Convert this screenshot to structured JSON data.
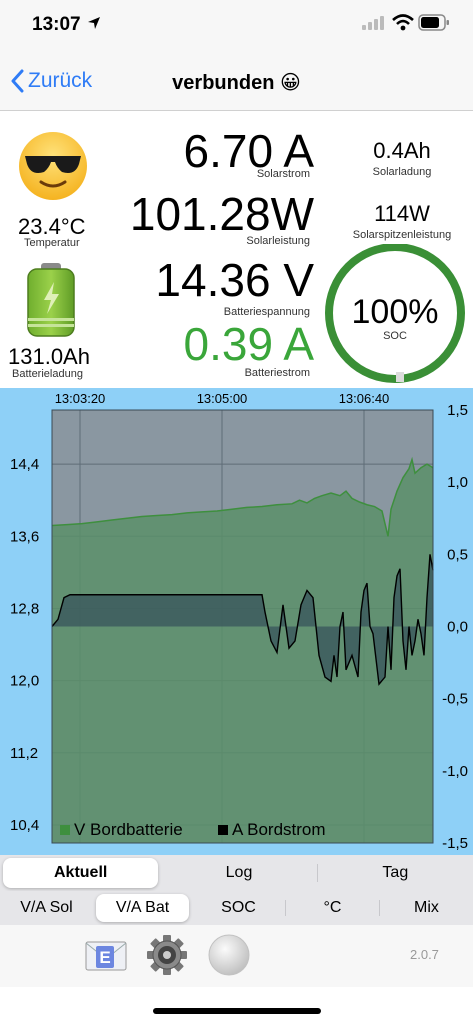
{
  "status_bar": {
    "time": "13:07"
  },
  "nav": {
    "back_label": "Zurück",
    "title": "verbunden 😀"
  },
  "dashboard": {
    "temperature": {
      "value": "23.4°C",
      "label": "Temperatur",
      "icon": "sunglasses-emoji-icon"
    },
    "battery_charge": {
      "value": "131.0Ah",
      "label": "Batterieladung",
      "icon": "battery-charging-icon"
    },
    "solar_current": {
      "value": "6.70 A",
      "label": "Solarstrom"
    },
    "solar_power": {
      "value": "101.28W",
      "label": "Solarleistung"
    },
    "battery_voltage": {
      "value": "14.36 V",
      "label": "Batteriespannung"
    },
    "battery_current": {
      "value": "0.39 A",
      "label": "Batteriestrom"
    },
    "solar_charge": {
      "value": "0.4Ah",
      "label": "Solarladung"
    },
    "solar_peak": {
      "value": "114W",
      "label": "Solarspitzenleistung"
    },
    "soc": {
      "value": "100%",
      "label": "SOC",
      "fraction": 1.0
    },
    "colors": {
      "green": "#3aa63a",
      "ring": "#3a8f36",
      "chart_bg": "#8ed0f7"
    }
  },
  "chart_data": {
    "type": "area",
    "x_ticks": [
      "13:03:20",
      "13:05:00",
      "13:06:40"
    ],
    "x_range": [
      "13:02:58",
      "13:07:02"
    ],
    "left_axis": {
      "ticks": [
        "14,4",
        "13,6",
        "12,8",
        "12,0",
        "11,2",
        "10,4"
      ],
      "ylim": [
        10.2,
        15.0
      ]
    },
    "right_axis": {
      "ticks": [
        "1,5",
        "1,0",
        "0,5",
        "0,0",
        "-0,5",
        "-1,0",
        "-1,5"
      ],
      "ylim": [
        -1.5,
        1.5
      ]
    },
    "legend": [
      "V Bordbatterie",
      "A Bordstrom"
    ],
    "legend_placement": "bottom",
    "grid": true,
    "series": [
      {
        "name": "V Bordbatterie",
        "axis": "left",
        "color": "#3e8f3e",
        "points": [
          [
            0,
            13.72
          ],
          [
            10,
            13.73
          ],
          [
            20,
            13.74
          ],
          [
            30,
            13.76
          ],
          [
            40,
            13.78
          ],
          [
            50,
            13.8
          ],
          [
            60,
            13.82
          ],
          [
            70,
            13.83
          ],
          [
            80,
            13.84
          ],
          [
            90,
            13.86
          ],
          [
            100,
            13.87
          ],
          [
            110,
            13.88
          ],
          [
            120,
            13.9
          ],
          [
            130,
            13.92
          ],
          [
            140,
            13.93
          ],
          [
            150,
            13.95
          ],
          [
            160,
            13.96
          ],
          [
            165,
            14.0
          ],
          [
            170,
            13.97
          ],
          [
            175,
            14.02
          ],
          [
            180,
            14.05
          ],
          [
            186,
            14.08
          ],
          [
            192,
            14.05
          ],
          [
            196,
            14.1
          ],
          [
            200,
            14.02
          ],
          [
            205,
            13.98
          ],
          [
            210,
            13.95
          ],
          [
            215,
            13.93
          ],
          [
            220,
            13.88
          ],
          [
            224,
            13.6
          ],
          [
            226,
            13.9
          ],
          [
            230,
            14.1
          ],
          [
            234,
            14.25
          ],
          [
            238,
            14.35
          ],
          [
            240,
            14.45
          ],
          [
            242,
            14.3
          ],
          [
            246,
            14.36
          ],
          [
            250,
            14.4
          ],
          [
            254,
            14.36
          ]
        ]
      },
      {
        "name": "A Bordstrom",
        "axis": "right",
        "color": "#000000",
        "points": [
          [
            0,
            0.0
          ],
          [
            4,
            0.05
          ],
          [
            8,
            0.2
          ],
          [
            12,
            0.22
          ],
          [
            40,
            0.22
          ],
          [
            80,
            0.22
          ],
          [
            120,
            0.22
          ],
          [
            140,
            0.22
          ],
          [
            142,
            0.1
          ],
          [
            146,
            -0.1
          ],
          [
            150,
            -0.18
          ],
          [
            154,
            0.15
          ],
          [
            156,
            0.0
          ],
          [
            158,
            -0.15
          ],
          [
            162,
            -0.1
          ],
          [
            166,
            0.15
          ],
          [
            170,
            0.25
          ],
          [
            174,
            0.2
          ],
          [
            178,
            -0.2
          ],
          [
            182,
            -0.35
          ],
          [
            186,
            -0.38
          ],
          [
            188,
            -0.2
          ],
          [
            190,
            -0.35
          ],
          [
            192,
            0.0
          ],
          [
            194,
            0.1
          ],
          [
            196,
            -0.3
          ],
          [
            200,
            -0.2
          ],
          [
            204,
            -0.35
          ],
          [
            206,
            0.1
          ],
          [
            208,
            0.25
          ],
          [
            210,
            0.3
          ],
          [
            212,
            0.0
          ],
          [
            214,
            -0.05
          ],
          [
            218,
            -0.4
          ],
          [
            222,
            -0.35
          ],
          [
            224,
            0.0
          ],
          [
            226,
            -0.3
          ],
          [
            228,
            0.2
          ],
          [
            230,
            0.35
          ],
          [
            232,
            0.4
          ],
          [
            234,
            -0.1
          ],
          [
            236,
            -0.3
          ],
          [
            238,
            0.0
          ],
          [
            240,
            -0.2
          ],
          [
            242,
            -0.1
          ],
          [
            244,
            0.05
          ],
          [
            246,
            -0.05
          ],
          [
            248,
            -0.2
          ],
          [
            250,
            0.2
          ],
          [
            252,
            0.5
          ],
          [
            254,
            0.39
          ]
        ]
      }
    ]
  },
  "period_tabs": [
    "Aktuell",
    "Log",
    "Tag"
  ],
  "period_selected": 0,
  "view_tabs": [
    "V/A Sol",
    "V/A Bat",
    "SOC",
    "°C",
    "Mix"
  ],
  "view_selected": 1,
  "toolbar": {
    "mail_icon": "mail-export-icon",
    "settings_icon": "gear-icon",
    "record_icon": "record-button-icon",
    "version": "2.0.7"
  }
}
